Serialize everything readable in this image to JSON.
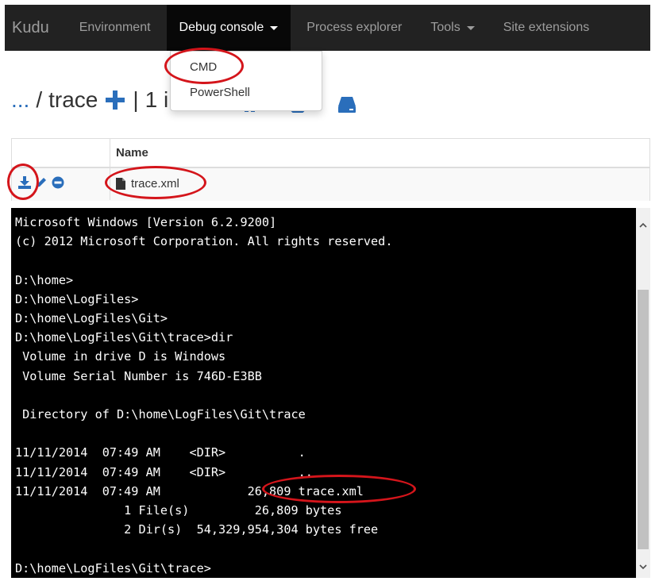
{
  "navbar": {
    "brand": "Kudu",
    "items": [
      {
        "label": "Environment"
      },
      {
        "label": "Debug console"
      },
      {
        "label": "Process explorer"
      },
      {
        "label": "Tools"
      },
      {
        "label": "Site extensions"
      }
    ]
  },
  "debug_menu": {
    "items": [
      {
        "label": "CMD"
      },
      {
        "label": "PowerShell"
      }
    ]
  },
  "breadcrumb": {
    "ellipsis": "...",
    "separator": "/",
    "current": "trace",
    "divider": "|",
    "count_text": "1 i"
  },
  "file_table": {
    "header_name": "Name",
    "rows": [
      {
        "name": "trace.xml"
      }
    ]
  },
  "console": {
    "lines": [
      "Microsoft Windows [Version 6.2.9200]",
      "(c) 2012 Microsoft Corporation. All rights reserved.",
      "",
      "D:\\home>",
      "D:\\home\\LogFiles>",
      "D:\\home\\LogFiles\\Git>",
      "D:\\home\\LogFiles\\Git\\trace>dir",
      " Volume in drive D is Windows",
      " Volume Serial Number is 746D-E3BB",
      "",
      " Directory of D:\\home\\LogFiles\\Git\\trace",
      "",
      "11/11/2014  07:49 AM    <DIR>          .",
      "11/11/2014  07:49 AM    <DIR>          ..",
      "11/11/2014  07:49 AM            26,809 trace.xml",
      "               1 File(s)         26,809 bytes",
      "               2 Dir(s)  54,329,954,304 bytes free",
      "",
      "D:\\home\\LogFiles\\Git\\trace>"
    ]
  },
  "colors": {
    "navbar_bg": "#222222",
    "navbar_active_bg": "#080808",
    "link_blue": "#2a6ebb",
    "annotation_red": "#d4151b",
    "console_bg": "#000000"
  },
  "icons": [
    "plus-icon",
    "download-icon",
    "pencil-icon",
    "minus-circle-icon",
    "file-icon",
    "drive-icon",
    "scroll-up-icon",
    "scroll-down-icon"
  ]
}
